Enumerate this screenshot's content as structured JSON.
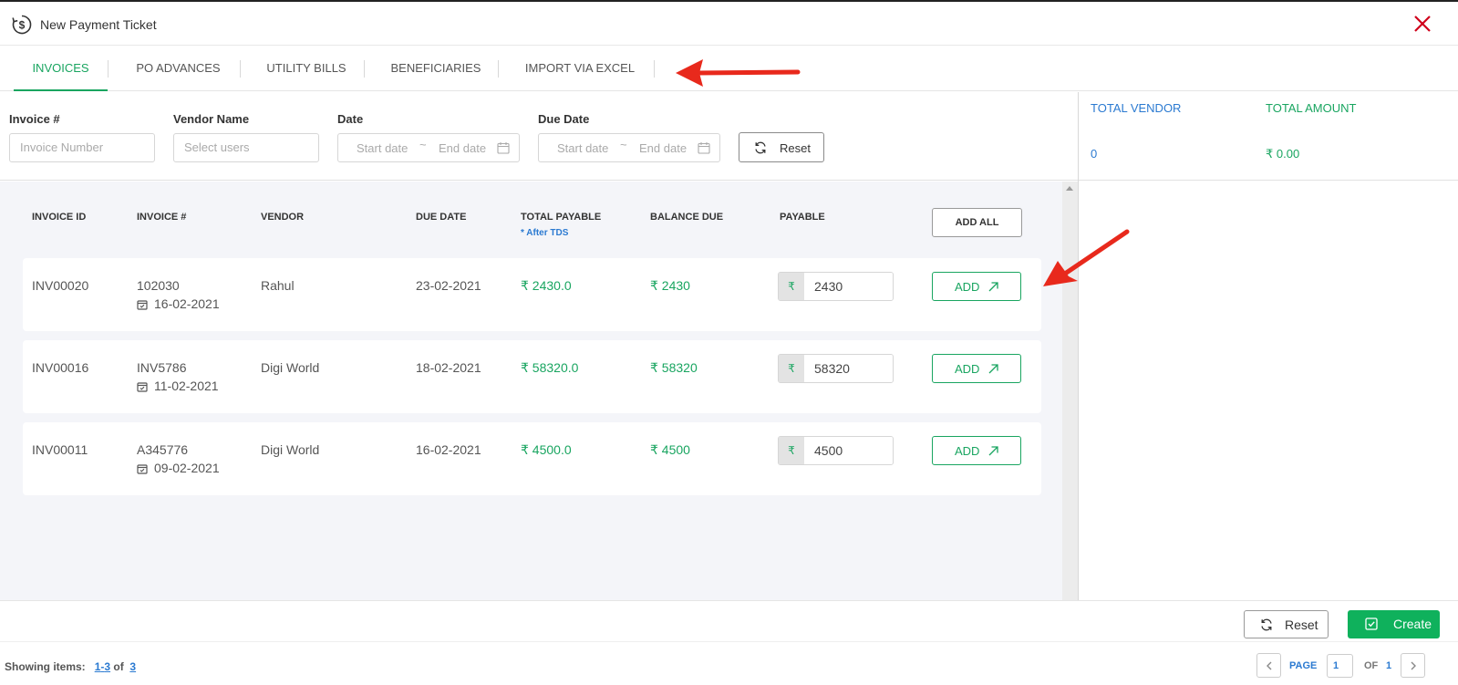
{
  "header": {
    "title": "New Payment Ticket",
    "logo_icon": "payment-cycle-icon",
    "close_icon": "close-icon"
  },
  "tabs": [
    {
      "label": "INVOICES",
      "active": true
    },
    {
      "label": "PO ADVANCES",
      "active": false
    },
    {
      "label": "UTILITY BILLS",
      "active": false
    },
    {
      "label": "BENEFICIARIES",
      "active": false
    },
    {
      "label": "IMPORT VIA EXCEL",
      "active": false
    }
  ],
  "filters": {
    "invoice_label": "Invoice #",
    "invoice_placeholder": "Invoice Number",
    "vendor_label": "Vendor Name",
    "vendor_placeholder": "Select users",
    "date_label": "Date",
    "date_start": "Start date",
    "date_sep": "~",
    "date_end": "End date",
    "due_label": "Due Date",
    "due_start": "Start date",
    "due_sep": "~",
    "due_end": "End date",
    "reset_label": "Reset"
  },
  "summary": {
    "total_vendor_label": "TOTAL VENDOR",
    "total_vendor_value": "0",
    "total_amount_label": "TOTAL AMOUNT",
    "total_amount_value": "₹ 0.00"
  },
  "table": {
    "columns": {
      "invoice_id": "INVOICE ID",
      "invoice_no": "INVOICE #",
      "vendor": "VENDOR",
      "due_date": "DUE DATE",
      "total_payable": "TOTAL PAYABLE",
      "total_payable_sub": "* After TDS",
      "balance_due": "BALANCE DUE",
      "payable": "PAYABLE"
    },
    "add_all_label": "ADD ALL",
    "rows": [
      {
        "invoice_id": "INV00020",
        "invoice_no": "102030",
        "invoice_date": "16-02-2021",
        "vendor": "Rahul",
        "due_date": "23-02-2021",
        "total_payable": "₹ 2430.0",
        "balance_due": "₹ 2430",
        "currency": "₹",
        "payable": "2430",
        "add_label": "ADD"
      },
      {
        "invoice_id": "INV00016",
        "invoice_no": "INV5786",
        "invoice_date": "11-02-2021",
        "vendor": "Digi World",
        "due_date": "18-02-2021",
        "total_payable": "₹ 58320.0",
        "balance_due": "₹ 58320",
        "currency": "₹",
        "payable": "58320",
        "add_label": "ADD"
      },
      {
        "invoice_id": "INV00011",
        "invoice_no": "A345776",
        "invoice_date": "09-02-2021",
        "vendor": "Digi World",
        "due_date": "16-02-2021",
        "total_payable": "₹ 4500.0",
        "balance_due": "₹ 4500",
        "currency": "₹",
        "payable": "4500",
        "add_label": "ADD"
      }
    ]
  },
  "actions": {
    "reset_label": "Reset",
    "create_label": "Create"
  },
  "pagination": {
    "showing_label": "Showing items:",
    "range_start": "1",
    "range_dash": "-",
    "range_end": "3",
    "of_label": "of",
    "total": "3",
    "page_label": "PAGE",
    "page_value": "1",
    "of_pages_label": "OF",
    "total_pages": "1"
  },
  "colors": {
    "accent_green": "#19a560",
    "accent_blue": "#2b7ad1",
    "close_red": "#d0021b",
    "arrow_red": "#e8291c"
  }
}
